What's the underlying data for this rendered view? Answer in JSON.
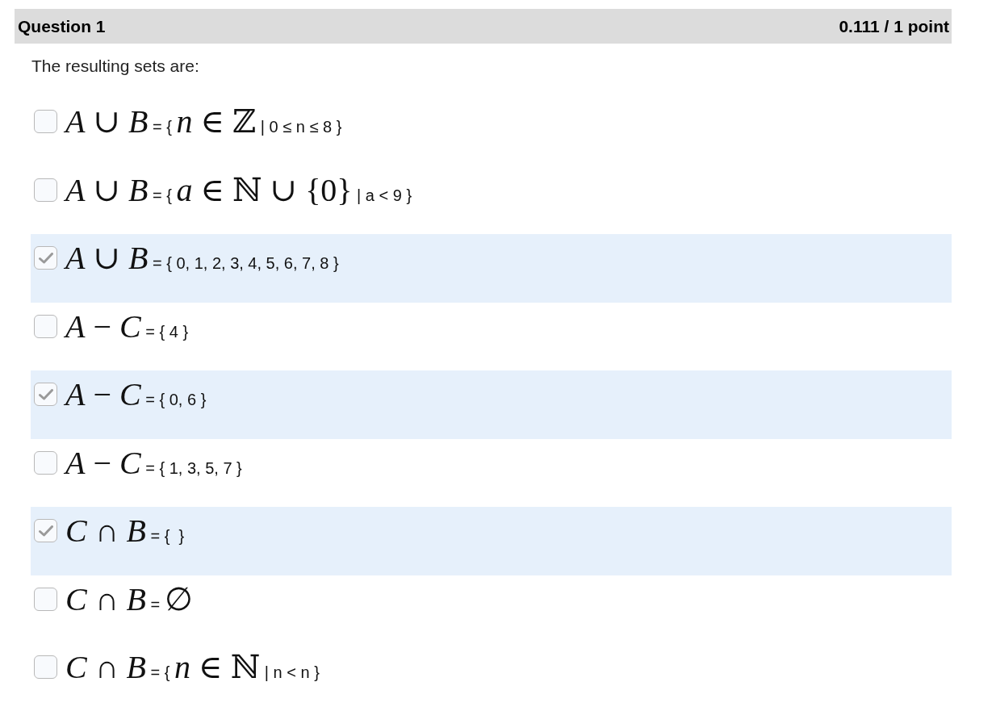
{
  "question": {
    "title": "Question 1",
    "score": "0.111 / 1 point"
  },
  "prompt": "The resulting sets are:",
  "options": [
    {
      "checked": false,
      "segments": [
        {
          "kind": "math",
          "text": "*A* ∪ *B*"
        },
        {
          "kind": "plain",
          "text": "= {"
        },
        {
          "kind": "math",
          "text": "*n* ∈ ℤ"
        },
        {
          "kind": "plain",
          "text": "| 0 ≤ n ≤ 8 }"
        }
      ]
    },
    {
      "checked": false,
      "segments": [
        {
          "kind": "math",
          "text": "*A* ∪ *B*"
        },
        {
          "kind": "plain",
          "text": "= {"
        },
        {
          "kind": "math",
          "text": "*a* ∈ ℕ ∪ {0}"
        },
        {
          "kind": "plain",
          "text": "| a < 9 }"
        }
      ]
    },
    {
      "checked": true,
      "segments": [
        {
          "kind": "math",
          "text": "*A* ∪ *B*"
        },
        {
          "kind": "plain",
          "text": "= { 0, 1, 2, 3, 4, 5, 6, 7, 8 }"
        }
      ]
    },
    {
      "checked": false,
      "segments": [
        {
          "kind": "math",
          "text": "*A* − *C*"
        },
        {
          "kind": "plain",
          "text": "= { 4 }"
        }
      ]
    },
    {
      "checked": true,
      "segments": [
        {
          "kind": "math",
          "text": "*A* − *C*"
        },
        {
          "kind": "plain",
          "text": "= { 0, 6 }"
        }
      ]
    },
    {
      "checked": false,
      "segments": [
        {
          "kind": "math",
          "text": "*A* − *C*"
        },
        {
          "kind": "plain",
          "text": "= { 1, 3, 5, 7 }"
        }
      ]
    },
    {
      "checked": true,
      "segments": [
        {
          "kind": "math",
          "text": "*C* ∩ *B*"
        },
        {
          "kind": "plain",
          "text": "= {  }"
        }
      ]
    },
    {
      "checked": false,
      "segments": [
        {
          "kind": "math",
          "text": "*C* ∩ *B*"
        },
        {
          "kind": "plain",
          "text": "="
        },
        {
          "kind": "math",
          "text": "∅"
        }
      ]
    },
    {
      "checked": false,
      "segments": [
        {
          "kind": "math",
          "text": "*C* ∩ *B*"
        },
        {
          "kind": "plain",
          "text": "= {"
        },
        {
          "kind": "math",
          "text": "*n* ∈ ℕ"
        },
        {
          "kind": "plain",
          "text": "| n < n }"
        }
      ]
    }
  ]
}
